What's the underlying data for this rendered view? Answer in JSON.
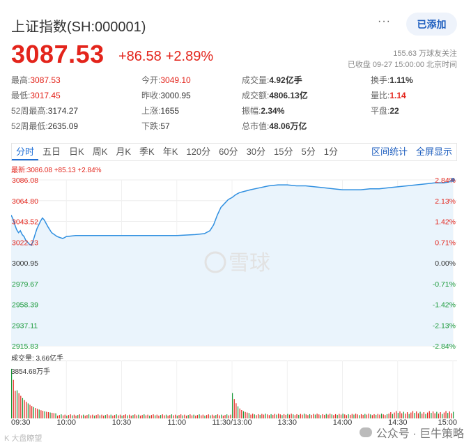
{
  "header": {
    "title": "上证指数(SH:000001)",
    "more": "···",
    "add_button": "已添加"
  },
  "quote": {
    "price": "3087.53",
    "change": "+86.58",
    "change_pct": "+2.89%",
    "followers": "155.63 万球友关注",
    "status": "已收盘 09-27 15:00:00 北京时间"
  },
  "stats": {
    "col1": [
      {
        "k": "最高:",
        "v": "3087.53"
      },
      {
        "k": "最低:",
        "v": "3017.45"
      },
      {
        "k": "52周最高:",
        "v": "3174.27"
      },
      {
        "k": "52周最低:",
        "v": "2635.09"
      }
    ],
    "col2": [
      {
        "k": "今开:",
        "v": "3049.10"
      },
      {
        "k": "昨收:",
        "v": "3000.95"
      },
      {
        "k": "上涨:",
        "v": "1655"
      },
      {
        "k": "下跌:",
        "v": "57"
      }
    ],
    "col3": [
      {
        "k": "成交量:",
        "v": "4.92亿手"
      },
      {
        "k": "成交额:",
        "v": "4806.13亿"
      },
      {
        "k": "振幅:",
        "v": "2.34%"
      },
      {
        "k": "总市值:",
        "v": "48.06万亿"
      }
    ],
    "col4": [
      {
        "k": "换手:",
        "v": "1.11%"
      },
      {
        "k": "量比:",
        "v": "1.14"
      },
      {
        "k": "平盘:",
        "v": "22"
      }
    ]
  },
  "tabs": [
    "分时",
    "五日",
    "日K",
    "周K",
    "月K",
    "季K",
    "年K",
    "120分",
    "60分",
    "30分",
    "15分",
    "5分",
    "1分"
  ],
  "tabs_right": [
    "区间统计",
    "全屏显示"
  ],
  "chart_latest": "最新:3086.08 +85.13 +2.84%",
  "watermark": "雪球",
  "volume_label": "成交量: 3.66亿手",
  "volume_max": "3854.68万手",
  "footer_left": "K 大盘瞭望",
  "footer_right": "公众号 · 巨牛策略",
  "chart_data": {
    "type": "line",
    "y_left": [
      "3086.08",
      "3064.80",
      "3043.52",
      "3022.23",
      "3000.95",
      "2979.67",
      "2958.39",
      "2937.11",
      "2915.83"
    ],
    "y_right": [
      "2.84%",
      "2.13%",
      "1.42%",
      "0.71%",
      "0.00%",
      "-0.71%",
      "-1.42%",
      "-2.13%",
      "-2.84%"
    ],
    "ylim": [
      2915.83,
      3086.08
    ],
    "x_ticks": [
      "09:30",
      "10:00",
      "10:30",
      "11:00",
      "11:30/13:00",
      "13:30",
      "14:00",
      "14:30",
      "15:00"
    ],
    "x_minutes": [
      0,
      30,
      60,
      90,
      120,
      150,
      180,
      210,
      240
    ],
    "series": [
      {
        "minute": [
          0,
          1,
          2,
          3,
          4,
          5,
          6,
          7,
          8,
          9,
          10,
          11,
          12,
          13,
          14,
          15,
          16,
          17,
          18,
          20,
          22,
          25,
          28,
          30,
          35,
          40,
          50,
          60,
          70,
          80,
          90,
          100,
          105,
          108,
          110,
          112,
          114,
          116,
          118,
          120,
          122,
          124,
          126,
          128,
          130,
          135,
          140,
          145,
          150,
          155,
          160,
          165,
          170,
          175,
          180,
          185,
          190,
          195,
          200,
          205,
          210,
          215,
          220,
          225,
          230,
          235,
          238,
          240
        ],
        "values": [
          3050,
          3046,
          3040,
          3035,
          3032,
          3034,
          3030,
          3028,
          3024,
          3022,
          3020,
          3019,
          3024,
          3030,
          3036,
          3040,
          3044,
          3047,
          3045,
          3038,
          3032,
          3028,
          3026,
          3028,
          3029,
          3029,
          3029,
          3029,
          3029,
          3029,
          3029,
          3030,
          3031,
          3034,
          3040,
          3050,
          3058,
          3062,
          3066,
          3068,
          3071,
          3073,
          3074,
          3075,
          3076,
          3078,
          3080,
          3081,
          3081,
          3080,
          3080,
          3079,
          3078,
          3077,
          3076,
          3076,
          3076,
          3077,
          3077,
          3078,
          3079,
          3080,
          3081,
          3082,
          3083,
          3083,
          3084,
          3086.08
        ]
      }
    ],
    "volume_max": 3854.68
  },
  "colors": {
    "up": "#e3241b",
    "down": "#1a9a3a",
    "line": "#2f8fe0",
    "fill": "#eaf4fc",
    "accent": "#1f5fbf"
  }
}
